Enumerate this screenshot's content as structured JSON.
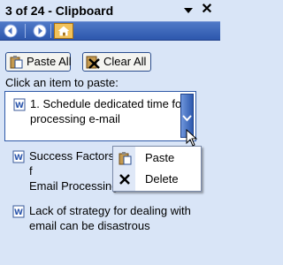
{
  "titlebar": {
    "title": "3 of 24 - Clipboard",
    "dropdown_icon": "triangle-down-icon",
    "close_icon": "close-icon"
  },
  "navigation": {
    "back_icon": "back-arrow-icon",
    "forward_icon": "forward-arrow-icon",
    "home_icon": "home-icon"
  },
  "toolbar": {
    "paste_all_label": "Paste All",
    "clear_all_label": "Clear All"
  },
  "instructions": "Click an item to paste:",
  "items": [
    {
      "line1": "1. Schedule dedicated time for",
      "line2": "processing e-mail",
      "icon": "word-document-icon",
      "selected": true
    },
    {
      "line1": "Success Factors f",
      "line2": "Email Processing",
      "icon": "word-document-icon",
      "selected": false
    },
    {
      "line1": "Lack of strategy for dealing with",
      "line2": "email can be disastrous",
      "icon": "word-document-icon",
      "selected": false
    }
  ],
  "context_menu": {
    "items": [
      {
        "label": "Paste",
        "icon": "paste-icon"
      },
      {
        "label": "Delete",
        "icon": "delete-icon"
      }
    ]
  },
  "colors": {
    "pane_background": "#d9e5f7",
    "nav_blue": "#2d57ad",
    "selection_border": "#2f5aa8",
    "home_button": "#f2c25a"
  }
}
